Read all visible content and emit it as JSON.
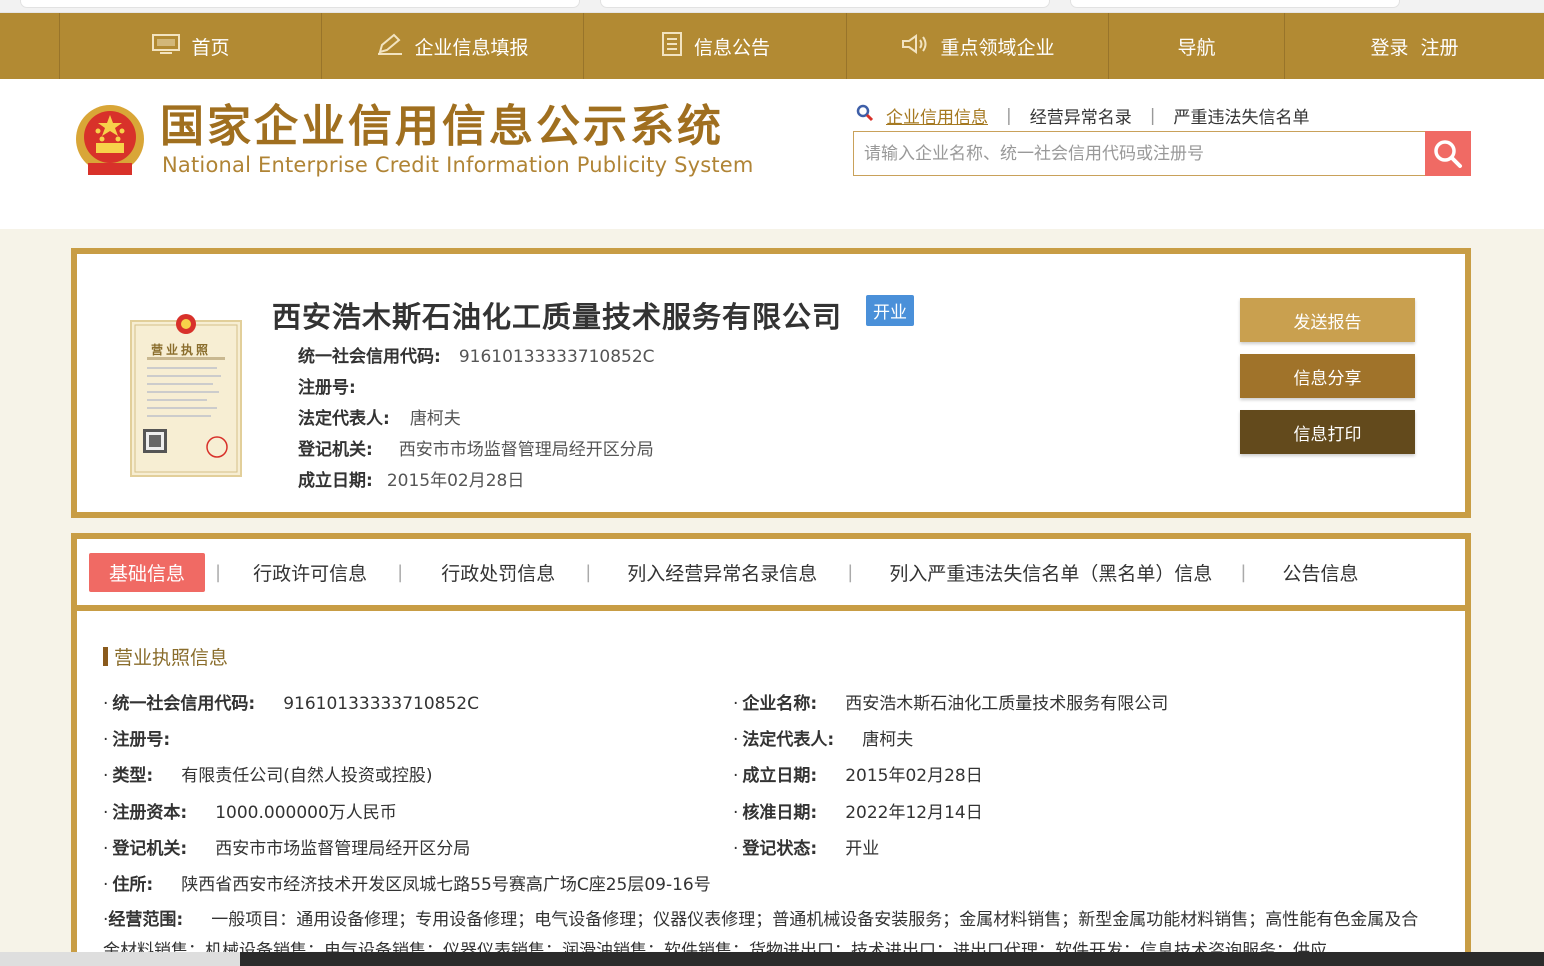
{
  "nav": {
    "items": [
      {
        "label": "首页",
        "icon": "monitor-icon"
      },
      {
        "label": "企业信息填报",
        "icon": "pen-icon"
      },
      {
        "label": "信息公告",
        "icon": "document-icon"
      },
      {
        "label": "重点领域企业",
        "icon": "speaker-icon"
      },
      {
        "label": "导航"
      },
      {
        "label": "登录  注册"
      }
    ]
  },
  "header": {
    "title_cn": "国家企业信用信息公示系统",
    "title_en": "National Enterprise Credit Information Publicity System",
    "search_tabs": [
      "企业信用信息",
      "经营异常名录",
      "严重违法失信名单"
    ],
    "search_placeholder": "请输入企业名称、统一社会信用代码或注册号"
  },
  "company": {
    "name": "西安浩木斯石油化工质量技术服务有限公司",
    "status_badge": "开业",
    "fields": [
      {
        "label": "统一社会信用代码:",
        "value": "91610133333710852C"
      },
      {
        "label": "注册号:",
        "value": ""
      },
      {
        "label": "法定代表人:",
        "value": "唐柯夫"
      },
      {
        "label": "登记机关:",
        "value": "西安市市场监督管理局经开区分局"
      },
      {
        "label": "成立日期:",
        "value": "2015年02月28日"
      }
    ],
    "buttons": {
      "send": "发送报告",
      "share": "信息分享",
      "print": "信息打印"
    },
    "license_title": "营业执照"
  },
  "tabs": [
    "基础信息",
    "行政许可信息",
    "行政处罚信息",
    "列入经营异常名录信息",
    "列入严重违法失信名单（黑名单）信息",
    "公告信息"
  ],
  "details": {
    "section_title": "营业执照信息",
    "left": [
      {
        "label": "统一社会信用代码:",
        "value": "91610133333710852C"
      },
      {
        "label": "注册号:",
        "value": ""
      },
      {
        "label": "类型:",
        "value": "有限责任公司(自然人投资或控股)"
      },
      {
        "label": "注册资本:",
        "value": "1000.000000万人民币"
      },
      {
        "label": "登记机关:",
        "value": "西安市市场监督管理局经开区分局"
      },
      {
        "label": "住所:",
        "value": "陕西省西安市经济技术开发区凤城七路55号赛高广场C座25层09-16号"
      }
    ],
    "right": [
      {
        "label": "企业名称:",
        "value": "西安浩木斯石油化工质量技术服务有限公司"
      },
      {
        "label": "法定代表人:",
        "value": "唐柯夫"
      },
      {
        "label": "成立日期:",
        "value": "2015年02月28日"
      },
      {
        "label": "核准日期:",
        "value": "2022年12月14日"
      },
      {
        "label": "登记状态:",
        "value": "开业"
      }
    ],
    "scope_label": "经营范围:",
    "scope_value": "一般项目：通用设备修理；专用设备修理；电气设备修理；仪器仪表修理；普通机械设备安装服务；金属材料销售；新型金属功能材料销售；高性能有色金属及合金材料销售；机械设备销售；电气设备销售；仪器仪表销售；润滑油销售；软件销售；货物进出口；技术进出口；进出口代理；软件开发；信息技术咨询服务；供应"
  },
  "colors": {
    "nav_bg": "#b28a33",
    "accent": "#c89d45",
    "active_tab": "#f06a64",
    "badge": "#4a90d9",
    "btn_send": "#c9a04f",
    "btn_share": "#a0732a",
    "btn_print": "#634a1c"
  }
}
